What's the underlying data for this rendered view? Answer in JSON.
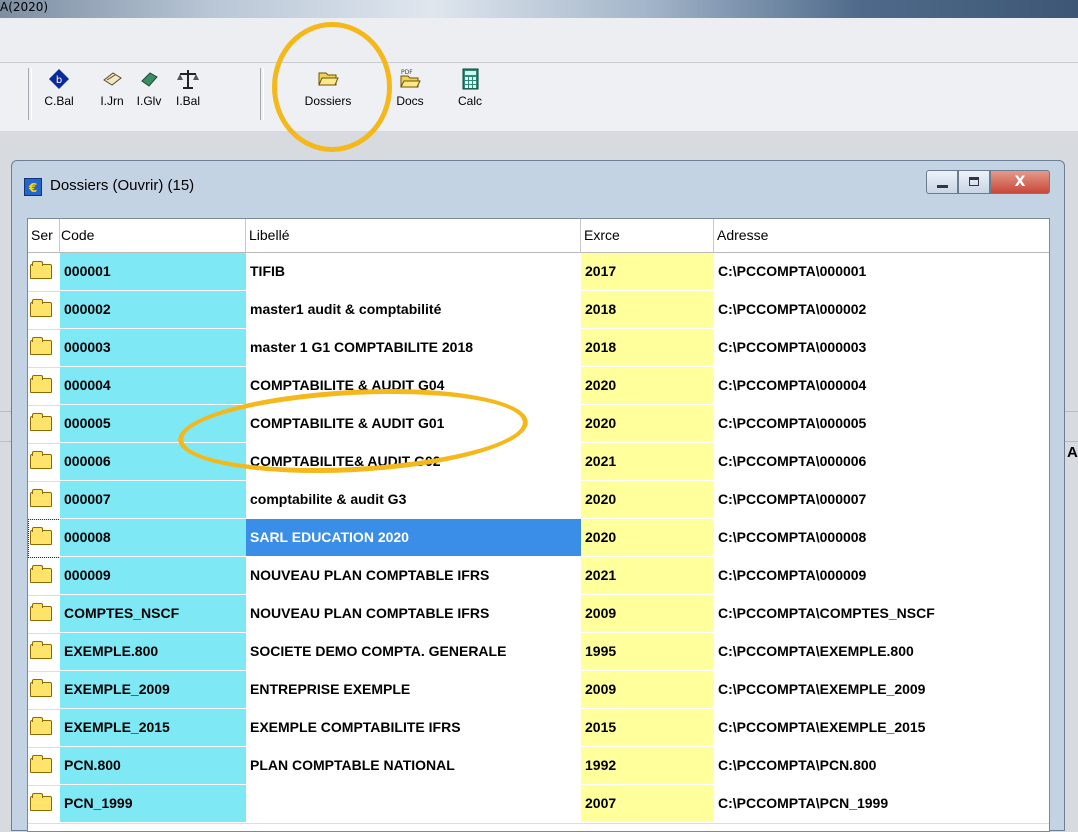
{
  "app": {
    "title_fragment": "A(2020)"
  },
  "toolbar": {
    "buttons": [
      {
        "id": "cbal",
        "label": "C.Bal",
        "icon": "blue-diamond-b-icon"
      },
      {
        "id": "ijrn",
        "label": "I.Jrn",
        "icon": "book-icon"
      },
      {
        "id": "iglv",
        "label": "I.Glv",
        "icon": "book-green-icon"
      },
      {
        "id": "ibal",
        "label": "I.Bal",
        "icon": "scale-icon"
      },
      {
        "id": "dossiers",
        "label": "Dossiers",
        "icon": "open-folder-icon"
      },
      {
        "id": "docs",
        "label": "Docs",
        "icon": "pdf-folder-icon"
      },
      {
        "id": "calc",
        "label": "Calc",
        "icon": "calculator-icon"
      }
    ]
  },
  "window": {
    "title": "Dossiers (Ouvrir)  (15)",
    "close_glyph": "X"
  },
  "table": {
    "headers": {
      "ser": "Ser",
      "code": "Code",
      "libelle": "Libellé",
      "exrce": "Exrce",
      "adresse": "Adresse"
    },
    "rows": [
      {
        "code": "000001",
        "libelle": "TIFIB",
        "exrce": "2017",
        "adresse": "C:\\PCCOMPTA\\000001"
      },
      {
        "code": "000002",
        "libelle": "master1 audit & comptabilité",
        "exrce": "2018",
        "adresse": "C:\\PCCOMPTA\\000002"
      },
      {
        "code": "000003",
        "libelle": "master 1 G1 COMPTABILITE 2018",
        "exrce": "2018",
        "adresse": "C:\\PCCOMPTA\\000003"
      },
      {
        "code": "000004",
        "libelle": "COMPTABILITE & AUDIT G04",
        "exrce": "2020",
        "adresse": "C:\\PCCOMPTA\\000004"
      },
      {
        "code": "000005",
        "libelle": "COMPTABILITE & AUDIT G01",
        "exrce": "2020",
        "adresse": "C:\\PCCOMPTA\\000005"
      },
      {
        "code": "000006",
        "libelle": "COMPTABILITE& AUDIT G02",
        "exrce": "2021",
        "adresse": "C:\\PCCOMPTA\\000006"
      },
      {
        "code": "000007",
        "libelle": "comptabilite & audit G3",
        "exrce": "2020",
        "adresse": "C:\\PCCOMPTA\\000007"
      },
      {
        "code": "000008",
        "libelle": "SARL EDUCATION 2020",
        "exrce": "2020",
        "adresse": "C:\\PCCOMPTA\\000008",
        "selected": true
      },
      {
        "code": "000009",
        "libelle": "NOUVEAU PLAN COMPTABLE IFRS",
        "exrce": "2021",
        "adresse": "C:\\PCCOMPTA\\000009"
      },
      {
        "code": "COMPTES_NSCF",
        "libelle": "NOUVEAU PLAN COMPTABLE IFRS",
        "exrce": "2009",
        "adresse": "C:\\PCCOMPTA\\COMPTES_NSCF"
      },
      {
        "code": "EXEMPLE.800",
        "libelle": "SOCIETE DEMO COMPTA. GENERALE",
        "exrce": "1995",
        "adresse": "C:\\PCCOMPTA\\EXEMPLE.800"
      },
      {
        "code": "EXEMPLE_2009",
        "libelle": "ENTREPRISE EXEMPLE",
        "exrce": "2009",
        "adresse": "C:\\PCCOMPTA\\EXEMPLE_2009"
      },
      {
        "code": "EXEMPLE_2015",
        "libelle": "EXEMPLE COMPTABILITE IFRS",
        "exrce": "2015",
        "adresse": "C:\\PCCOMPTA\\EXEMPLE_2015"
      },
      {
        "code": "PCN.800",
        "libelle": "PLAN COMPTABLE NATIONAL",
        "exrce": "1992",
        "adresse": "C:\\PCCOMPTA\\PCN.800"
      },
      {
        "code": "PCN_1999",
        "libelle": "",
        "exrce": "2007",
        "adresse": "C:\\PCCOMPTA\\PCN_1999"
      }
    ]
  },
  "background": {
    "right_letter": "A"
  },
  "colors": {
    "code_bg": "#7ee8f5",
    "exrce_bg": "#ffff9c",
    "selection": "#3b8ee8",
    "highlight_ring": "#f5b81a"
  }
}
